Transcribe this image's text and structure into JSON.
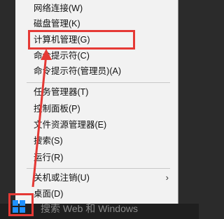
{
  "menu": {
    "items": [
      {
        "label": "网络连接(W)"
      },
      {
        "label": "磁盘管理(K)"
      },
      {
        "label": "计算机管理(G)"
      },
      {
        "label": "命令提示符(C)"
      },
      {
        "label": "命令提示符(管理员)(A)"
      },
      {
        "label": "任务管理器(T)"
      },
      {
        "label": "控制面板(P)"
      },
      {
        "label": "文件资源管理器(E)"
      },
      {
        "label": "搜索(S)"
      },
      {
        "label": "运行(R)"
      },
      {
        "label": "关机或注销(U)"
      },
      {
        "label": "桌面(D)"
      }
    ]
  },
  "taskbar": {
    "search_placeholder": "搜索 Web 和 Windows"
  },
  "colors": {
    "annotation": "#e53935",
    "windows_blue": "#1e90ff"
  }
}
